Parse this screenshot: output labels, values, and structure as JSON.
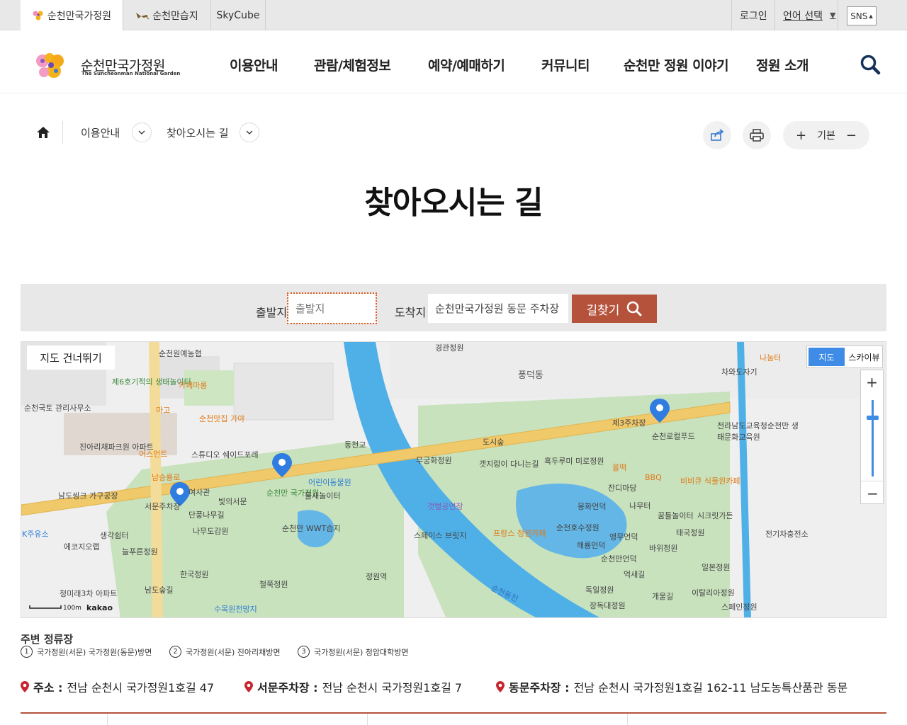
{
  "topbar": {
    "site_tabs": [
      {
        "label": "순천만국가정원",
        "active": true
      },
      {
        "label": "순천만습지",
        "active": false
      },
      {
        "label": "SkyCube",
        "active": false
      }
    ],
    "login": "로그인",
    "language": "언어 선택",
    "sns": "SNS"
  },
  "header": {
    "logo_text": "순천만국가정원",
    "logo_sub": "The Suncheonman National Garden",
    "nav": [
      "이용안내",
      "관람/체험정보",
      "예약/예매하기",
      "커뮤니티",
      "순천만 정원 이야기",
      "정원 소개"
    ]
  },
  "breadcrumb": {
    "level1": "이용안내",
    "level2": "찾아오시는 길"
  },
  "tools": {
    "zoom_in": "+",
    "zoom_label": "기본",
    "zoom_out": "−"
  },
  "page_title": "찾아오시는 길",
  "route": {
    "start_label": "출발지",
    "start_placeholder": "출발지",
    "end_label": "도착지",
    "end_value": "순천만국가정원 동문 주차장",
    "button": "길찾기"
  },
  "map": {
    "skip": "지도 건너뛰기",
    "type_map": "지도",
    "type_sky": "스카이뷰",
    "scale": "100m",
    "brand": "kakao",
    "labels": {
      "l1": "순천원예농협",
      "l2": "제6호기적의 생태놀이터",
      "l3": "카페마롱",
      "l4": "순천국토 관리사무소",
      "l5": "마고",
      "l6": "순천맛집 가야",
      "l7": "진아리채파크원 아파트",
      "l8": "어스먼트",
      "l9": "스튜디오 쉐이드포레",
      "l10": "남승룡로",
      "l11": "남도씽크 가구공장",
      "l12": "서문주차장",
      "l13": "여사관",
      "l14": "빛의서문",
      "l15": "순천만 국가정원",
      "l16": "어린이동물원",
      "l17": "물새놀이터",
      "l18": "단풍나무길",
      "l19": "나무도감원",
      "l20": "순천만 WWT습지",
      "l21": "생각쉼터",
      "l22": "에코지오랩",
      "l23": "늘푸른정원",
      "l24": "한국정원",
      "l25": "청미래3차 아파트",
      "l26": "남도숲길",
      "l27": "수목원전망지",
      "l28": "철쭉정원",
      "l29": "정원역",
      "l30": "경관정원",
      "l31": "풍덕동",
      "l32": "도시숲",
      "l33": "무궁화정원",
      "l34": "갯지렁이 다니는길",
      "l35": "흑두루미 미로정원",
      "l36": "갯벌공연장",
      "l37": "스페이스 브릿지",
      "l38": "프랑스 정원카페",
      "l39": "몽화언덕",
      "l40": "순천호수정원",
      "l41": "해룡언덕",
      "l42": "앵무언덕",
      "l43": "순천만언덕",
      "l44": "억새길",
      "l45": "독일정원",
      "l46": "장독대정원",
      "l47": "올떡",
      "l48": "잔디마당",
      "l49": "BBQ",
      "l50": "비비큐 식물원카페",
      "l51": "제3주차장",
      "l52": "순천로컬푸드",
      "l53": "나무터",
      "l54": "꿈틀놀이터",
      "l55": "시크릿가든",
      "l56": "태국정원",
      "l57": "바위정원",
      "l58": "일본정원",
      "l59": "개울길",
      "l60": "이탈리아정원",
      "l61": "스페인정원",
      "l62": "나눔터",
      "l63": "차와도자기",
      "l64": "전라남도교육청순천만 생태문화교육원",
      "l65": "전기차충전소",
      "l66": "동천교",
      "l67": "순천동천",
      "l68": "K주유소"
    }
  },
  "stops": {
    "title": "주변 정류장",
    "items": [
      {
        "num": "1",
        "label": "국가정원(서문) 국가정원(동문)방면"
      },
      {
        "num": "2",
        "label": "국가정원(서문) 진아리채방면"
      },
      {
        "num": "3",
        "label": "국가정원(서문) 청암대학방면"
      }
    ]
  },
  "addresses": [
    {
      "title": "주소 :",
      "value": "전남 순천시 국가정원1호길 47"
    },
    {
      "title": "서문주차장 :",
      "value": "전남 순천시 국가정원1호길 7"
    },
    {
      "title": "동문주차장 :",
      "value": "전남 순천시 국가정원1호길 162-11 남도농특산품관 동문"
    }
  ],
  "colors": {
    "accent": "#b5523b",
    "map_water": "#4fb0e8",
    "map_park": "#c9e3c0",
    "map_road": "#f0c96a",
    "focus": "#e25a1c"
  }
}
